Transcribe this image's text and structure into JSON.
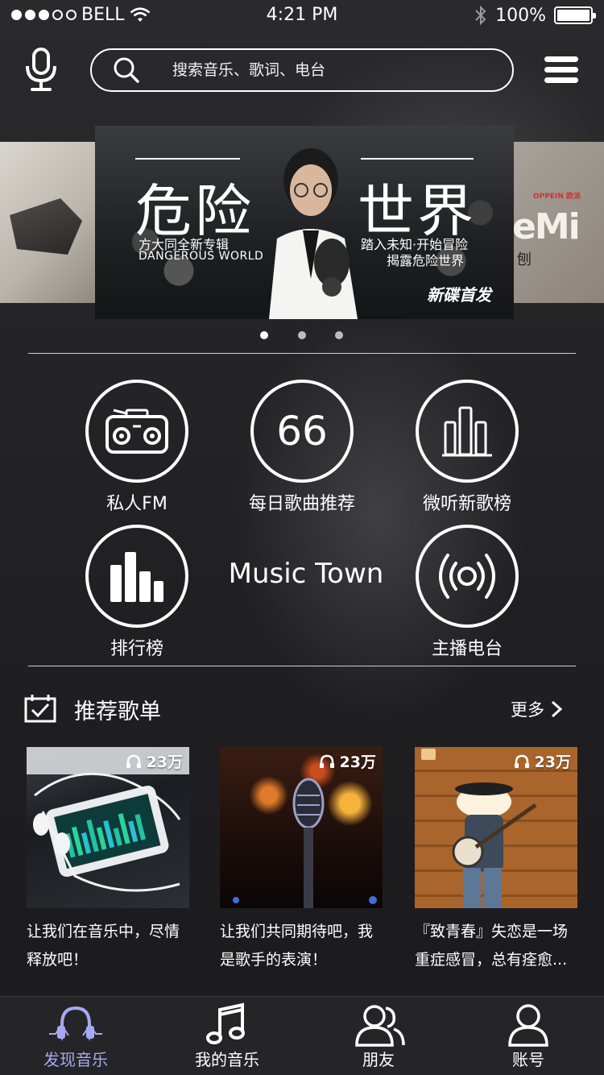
{
  "status_bar": {
    "carrier": "BELL",
    "time": "4:21 PM",
    "battery": "100%"
  },
  "search": {
    "placeholder": "搜索音乐、歌词、电台"
  },
  "banner": {
    "title_left": "危险",
    "title_right": "世界",
    "subtitle_left": "方大同全新专辑",
    "subtitle_left_en": "DANGEROUS WORLD",
    "subtitle_right": "踏入未知·开始冒险",
    "subtitle_right2": "揭露危险世界",
    "tag": "新碟首发",
    "side_right_brand": "OPPEIN 欧派",
    "side_right_text": "eMi",
    "side_right_sub": "刨",
    "pages": 3,
    "active_page": 1
  },
  "features": {
    "fm": "私人FM",
    "daily": "每日歌曲推荐",
    "daily_number": "66",
    "new_songs": "微听新歌榜",
    "charts": "排行榜",
    "center_title": "Music Town",
    "radio": "主播电台"
  },
  "recommend": {
    "title": "推荐歌单",
    "more": "更多",
    "items": [
      {
        "plays": "23万",
        "desc_line1": "让我们在音乐中，尽情",
        "desc_line2": "释放吧！"
      },
      {
        "plays": "23万",
        "desc_line1": "让我们共同期待吧，我",
        "desc_line2": "是歌手的表演！"
      },
      {
        "plays": "23万",
        "desc_line1": "『致青春』失恋是一场",
        "desc_line2": "重症感冒，总有痊愈..."
      }
    ]
  },
  "tabbar": {
    "items": [
      {
        "label": "发现音乐",
        "icon": "headphones-icon",
        "active": true
      },
      {
        "label": "我的音乐",
        "icon": "music-note-icon",
        "active": false
      },
      {
        "label": "朋友",
        "icon": "friends-icon",
        "active": false
      },
      {
        "label": "账号",
        "icon": "account-icon",
        "active": false
      }
    ]
  },
  "colors": {
    "accent": "#a7a8f2",
    "background": "#232326",
    "tabbar": "#252527"
  }
}
